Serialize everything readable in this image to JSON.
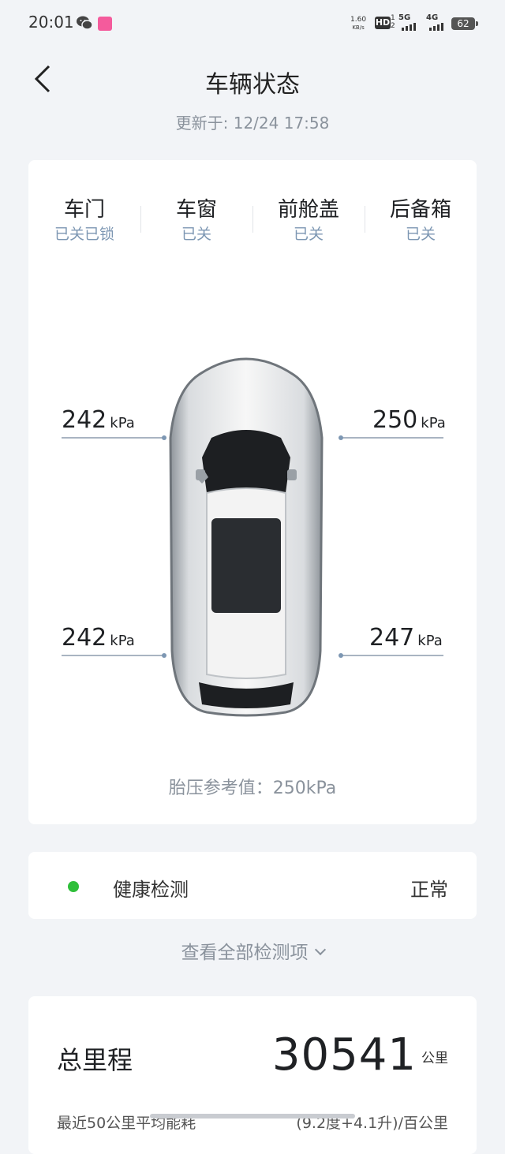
{
  "status_bar": {
    "time": "20:01",
    "net_speed_value": "1.60",
    "net_speed_unit": "KB/s",
    "hd_label": "HD",
    "hd_sub": "1\n2",
    "signal1_label": "5G",
    "signal2_label": "4G",
    "battery": "62"
  },
  "header": {
    "title": "车辆状态",
    "updated": "更新于: 12/24 17:58"
  },
  "vehicle_status": [
    {
      "name": "车门",
      "value": "已关已锁"
    },
    {
      "name": "车窗",
      "value": "已关"
    },
    {
      "name": "前舱盖",
      "value": "已关"
    },
    {
      "name": "后备箱",
      "value": "已关"
    }
  ],
  "tires": {
    "front_left": {
      "value": "242",
      "unit": "kPa"
    },
    "front_right": {
      "value": "250",
      "unit": "kPa"
    },
    "rear_left": {
      "value": "242",
      "unit": "kPa"
    },
    "rear_right": {
      "value": "247",
      "unit": "kPa"
    },
    "reference": "胎压参考值：250kPa"
  },
  "health": {
    "label": "健康检测",
    "status": "正常",
    "status_color": "#2fbf3a",
    "view_all": "查看全部检测项"
  },
  "mileage": {
    "label": "总里程",
    "value": "30541",
    "unit": "公里",
    "energy_label": "最近50公里平均能耗",
    "energy_value": "(9.2度+4.1升)/百公里"
  },
  "colors": {
    "background": "#f2f4f7",
    "status_value": "#7d97b3",
    "muted_text": "#8a929c"
  }
}
